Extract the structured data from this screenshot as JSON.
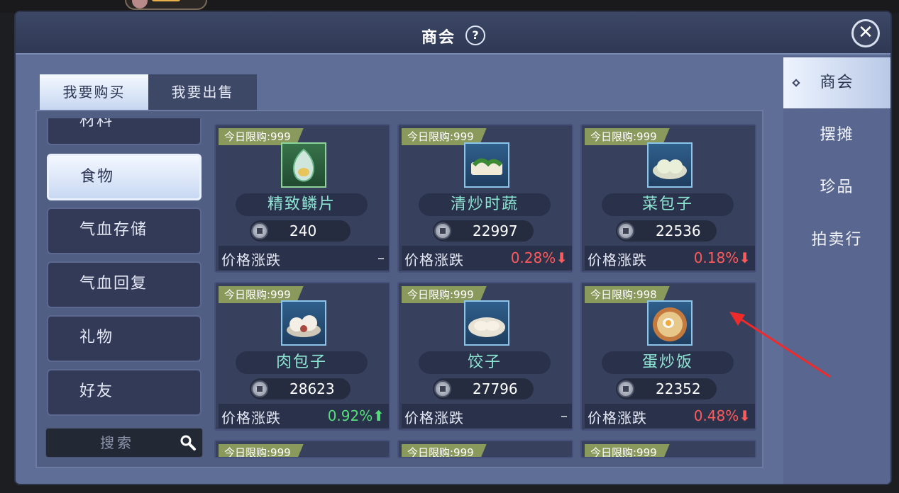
{
  "window": {
    "title": "商会"
  },
  "tabs": {
    "buy": "我要购买",
    "sell": "我要出售"
  },
  "categories": [
    "材料",
    "食物",
    "气血存储",
    "气血回复",
    "礼物",
    "好友"
  ],
  "search": {
    "placeholder": "搜索"
  },
  "items": [
    {
      "limit": "今日限购:999",
      "name": "精致鳞片",
      "price": "240",
      "change_label": "价格涨跌",
      "change": "–"
    },
    {
      "limit": "今日限购:999",
      "name": "清炒时蔬",
      "price": "22997",
      "change_label": "价格涨跌",
      "change": "0.28%⬇"
    },
    {
      "limit": "今日限购:999",
      "name": "菜包子",
      "price": "22536",
      "change_label": "价格涨跌",
      "change": "0.18%⬇"
    },
    {
      "limit": "今日限购:999",
      "name": "肉包子",
      "price": "28623",
      "change_label": "价格涨跌",
      "change": "0.92%⬆"
    },
    {
      "limit": "今日限购:999",
      "name": "饺子",
      "price": "27796",
      "change_label": "价格涨跌",
      "change": "–"
    },
    {
      "limit": "今日限购:998",
      "name": "蛋炒饭",
      "price": "22352",
      "change_label": "价格涨跌",
      "change": "0.48%⬇"
    }
  ],
  "partial_row": [
    "今日限购:999",
    "今日限购:999",
    "今日限购:999"
  ],
  "right_nav": [
    "商会",
    "摆摊",
    "珍品",
    "拍卖行"
  ],
  "colors": {
    "down": "#ff5a5a",
    "up": "#53e07a",
    "name": "#8de6d4"
  }
}
